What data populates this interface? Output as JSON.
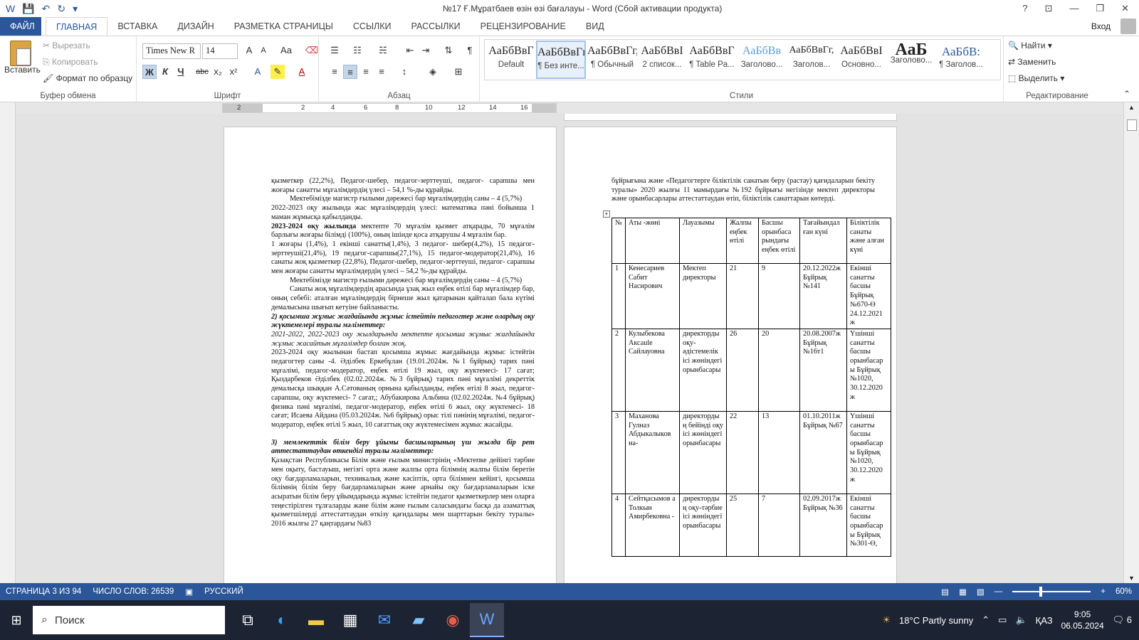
{
  "window": {
    "title": "№17 Ғ.Мұратбаев өзін өзі бағалауы - Word (Сбой активации продукта)",
    "help": "?",
    "signin": "Вход"
  },
  "tabs": [
    "ФАЙЛ",
    "ГЛАВНАЯ",
    "ВСТАВКА",
    "ДИЗАЙН",
    "РАЗМЕТКА СТРАНИЦЫ",
    "ССЫЛКИ",
    "РАССЫЛКИ",
    "РЕЦЕНЗИРОВАНИЕ",
    "ВИД"
  ],
  "clipboard": {
    "paste": "Вставить",
    "cut": "Вырезать",
    "copy": "Копировать",
    "format_painter": "Формат по образцу",
    "label": "Буфер обмена"
  },
  "font": {
    "name": "Times New R",
    "size": "14",
    "label": "Шрифт",
    "bold": "Ж",
    "italic": "К",
    "underline": "Ч",
    "strike": "abc",
    "sub": "x₂",
    "sup": "x²",
    "grow": "A",
    "shrink": "A",
    "case": "Aa"
  },
  "paragraph": {
    "label": "Абзац"
  },
  "styles": {
    "label": "Стили",
    "items": [
      {
        "preview": "АаБбВвГ",
        "name": "Default"
      },
      {
        "preview": "АаБбВвГг,",
        "name": "¶ Без инте..."
      },
      {
        "preview": "АаБбВвГг,",
        "name": "¶ Обычный"
      },
      {
        "preview": "АаБбВвІ",
        "name": "2 список..."
      },
      {
        "preview": "АаБбВвГ",
        "name": "¶ Table Pa..."
      },
      {
        "preview": "АаБбВв",
        "name": "Заголово..."
      },
      {
        "preview": "АаБбВвГг,",
        "name": "Заголов..."
      },
      {
        "preview": "АаБбВвІ",
        "name": "Основно..."
      },
      {
        "preview": "АаБ",
        "name": "Заголово..."
      },
      {
        "preview": "АаБбВ:",
        "name": "¶ Заголов..."
      }
    ]
  },
  "editing": {
    "find": "Найти",
    "replace": "Заменить",
    "select": "Выделить",
    "label": "Редактирование"
  },
  "ruler": [
    "2",
    "2",
    "4",
    "6",
    "8",
    "10",
    "12",
    "14",
    "16"
  ],
  "page1": {
    "paragraphs": [
      {
        "text": "қызметкер (22,2%),  Педагог-шебер, педагог-зерттеуші, педагог- сарапшы мен жоғары санатты мұғалімдердің үлесі – 54,1 %-ды құрайды.",
        "style": "plain"
      },
      {
        "text": "Мектебімізде магистр ғылыми дәрежесі бар мұғалімдердің саны – 4 (5,7%)",
        "style": "indent"
      },
      {
        "text": "2022-2023 оқу жылында жас мұғалімдердің үлесі: математика пәні бойынша 1 маман жұмысқа қабылданды.",
        "style": "plain"
      },
      {
        "bold": "2023-2024 оқу жылында",
        "text": " мектепте 70 мұғалім қызмет атқарады, 70 мұғалім барлығы жоғары білімді (100%), оның ішінде  қоса атқарушы 4  мұғалім бар.",
        "style": "mixed"
      },
      {
        "text": " 1 жоғары (1,4%),    1 екінші санатты(1,4%),    3 педагог- шебер(4,2%),    15 педагог- зерттеуші(21,4%),     19 педагог-сарапшы(27,1%),      15 педагог-модератор(21,4%),      16 санаты жоқ қызметкер (22,8%),    Педагог-шебер, педагог-зерттеуші, педагог- сарапшы мен жоғары санатты мұғалімдердің үлесі – 54,2 %-ды құрайды.",
        "style": "plain"
      },
      {
        "text": "Мектебімізде магистр ғылыми дәрежесі бар мұғалімдердің саны – 4 (5,7%)",
        "style": "indent"
      },
      {
        "text": "Санаты жоқ мұғалімдердің арасында ұзақ жыл еңбек өтілі бар мұғалімдер бар, оның себебі: аталған мұғалімдердің бірнеше жыл қатарынан қайталап бала күтімі демалысына шығып кетуіне байланысты.",
        "style": "indent"
      },
      {
        "text": "2) қосымша жұмыс жағдайында жұмыс істейтін педагогтер және олардың оқу жүктемелері туралы мәліметтер:",
        "style": "bi"
      },
      {
        "text": "2021-2022, 2022-2023 оқу жылдарында мектепте қосымша жұмыс жағдайында жұмыс жасайтын мұғалімдер болған жоқ.",
        "style": "i"
      },
      {
        "text": "2023-2024 оқу жылынан бастап қосымша жұмыс жағдайында жұмыс істейтін педагогтер саны -4. Әділбек Еркебұлан (19.01.2024ж. №1 бұйрық) тарих пәні мұғалімі, педагог-модератор, еңбек өтілі 19 жыл, оқу жүктемесі- 17  сағат; Қыздарбеков Әділбек (02.02.2024ж. №3 бұйрық) тарих пәні мұғалімі декреттік демалысқа шыққан А.Сәтованың орнына қабылданды, еңбек өтілі 8 жыл, педагог-сарапшы, оқу жүктемесі- 7 сағат,; Абубакирова Альбина (02.02.2024ж. №4 бұйрық) физика пәні мұғалімі, педагог-модератор,  еңбек өтілі 6 жыл, оқу жүктемесі- 18 сағат; Исаева Айдана (05.03.2024ж. №6 бұйрық) орыс тілі  пәнінің мұғалімі, педагог-модератор, еңбек өтілі 5 жыл, 10 сағаттық оқу жүктемесімен жұмыс жасайды.",
        "style": "plain"
      },
      {
        "text": "3) мемлекеттік білім беру ұйымы басшыларының үш жылда бір рет аттестаттаудан өткендігі туралы мәліметтер:",
        "style": "bi_gap"
      },
      {
        "text": "Қазақстан Республикасы Білім және ғылым министрінің «Мектепке дейінгі тәрбие мен оқыту, бастауыш, негізгі орта және жалпы орта білімнің жалпы білім беретін оқу бағдарламаларын, техникалық және кәсіптік, орта білімнен кейінгі, қосымша білімнің білім беру бағдарламаларын және арнайы оқу бағдарламаларын іске асыратын білім беру ұйымдарында жұмыс істейтін педагог қызметкерлер мен оларға теңестірілген тұлғаларды және білім және ғылым саласындағы басқа да азаматтық қызметшілерді аттестаттаудан өткізу қағидалары мен шарттарын бекіту туралы» 2016 жылғы 27 қаңтардағы №83",
        "style": "plain"
      }
    ]
  },
  "page2": {
    "intro": "бұйрығына және «Педагогтерге біліктілік санатын беру (растау) қағидаларын бекіту туралы» 2020 жылғы 11 мамырдағы №192 бұйрығы негізінде  мектеп директоры және орынбасарлары аттестаттаудан өтіп, біліктілік санаттарын көтерді.",
    "table": {
      "headers": [
        "№",
        "Аты -жөні",
        "Лауазымы",
        "Жалпы еңбек өтілі",
        "Басшы орынбаса рындағы еңбек өтілі",
        "Тағайындал ған күні",
        "Біліктілік санаты және алған күні"
      ],
      "rows": [
        [
          "1",
          "Кенесариев Сабит Насирович",
          "Мектеп директоры",
          "21",
          "9",
          "20.12.2022ж Бұйрық №141",
          "Екінші санатты басшы Бұйрық №670-Ө 24.12.2021 ж"
        ],
        [
          "2",
          "Кулыбекова Аксаule Сайлауовна",
          "директорды оқу-әдістемелік ісі жөніндегі орынбасары",
          "26",
          "20",
          "20.08.2007ж Бұйрық №16т1",
          "Үшінші санатты басшы орынбасар ы Бұйрық №1020, 30.12.2020 ж"
        ],
        [
          "3",
          "Маханова Гулназ Абдыкалыков на-",
          "директорды ң бейінді оқу ісі жөніндегі орынбасары",
          "22",
          "13",
          "01.10.2011ж Бұйрық №67",
          "Үшінші санатты басшы орынбасар ы Бұйрық №1020, 30.12.2020 ж"
        ],
        [
          "4",
          "Сейтқасымов а Толкын Амирбековна -",
          "директорды ң оқу-тәрбие ісі жөніндегі орынбасары",
          "25",
          "7",
          "02.09.2017ж Бұйрық №36",
          "Екінші санатты басшы орынбасар ы Бұйрық №301-Ө,"
        ]
      ]
    }
  },
  "status": {
    "page": "СТРАНИЦА 3 ИЗ 94",
    "words": "ЧИСЛО СЛОВ: 26539",
    "lang": "РУССКИЙ",
    "zoom": "60%"
  },
  "taskbar": {
    "search": "Поиск",
    "weather": "18°C  Partly sunny",
    "lang": "ҚАЗ",
    "time": "9:05",
    "date": "06.05.2024",
    "notif": "6"
  }
}
